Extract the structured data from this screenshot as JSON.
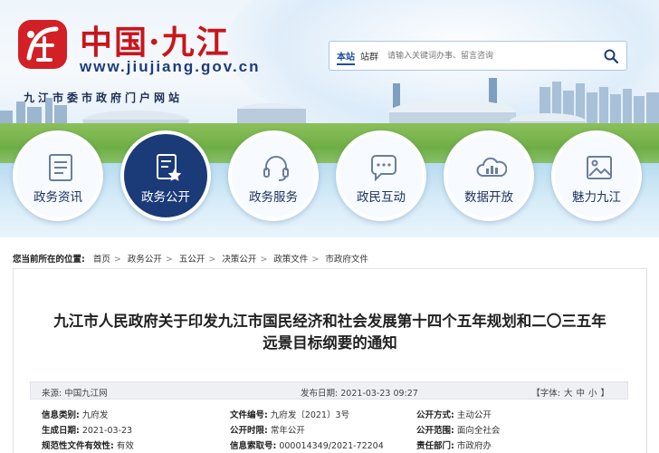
{
  "site": {
    "name_cn": "中国·九江",
    "url": "www.jiujiang.gov.cn",
    "portal": "九江市委市政府门户网站",
    "brand_red": "#c8161d",
    "brand_navy": "#1a3a78"
  },
  "search": {
    "scope_items": [
      "本站",
      "站群"
    ],
    "placeholder": "请输入关键词办事、留言咨询",
    "button_icon": "search-icon"
  },
  "nav": [
    {
      "label": "政务资讯",
      "icon": "document-list-icon",
      "active": false
    },
    {
      "label": "政务公开",
      "icon": "document-star-icon",
      "active": true
    },
    {
      "label": "政务服务",
      "icon": "headset-icon",
      "active": false
    },
    {
      "label": "政民互动",
      "icon": "chat-bubble-icon",
      "active": false
    },
    {
      "label": "数据开放",
      "icon": "bar-cloud-icon",
      "active": false
    },
    {
      "label": "魅力九江",
      "icon": "image-icon",
      "active": false
    }
  ],
  "breadcrumb": {
    "lead": "您当前所在的位置:",
    "items": [
      "首页",
      "政务公开",
      "五公开",
      "决策公开",
      "政策文件",
      "市政府文件"
    ]
  },
  "article": {
    "title_line1": "九江市人民政府关于印发九江市国民经济和社会发展第十四个五年规划和二〇三五年",
    "title_line2": "远景目标纲要的通知",
    "source_label": "来源:",
    "source_value": "中国九江网",
    "date_label": "发布日期:",
    "date_value": "2021-03-23 09:27",
    "font_label": "【字体:",
    "font_sizes": [
      "大",
      "中",
      "小"
    ],
    "font_close": "】"
  },
  "info": [
    [
      {
        "k": "信息类别:",
        "v": "九府发"
      },
      {
        "k": "文件编号:",
        "v": "九府发〔2021〕3号"
      },
      {
        "k": "公开方式:",
        "v": "主动公开"
      }
    ],
    [
      {
        "k": "生成日期:",
        "v": "2021-03-23"
      },
      {
        "k": "公开时限:",
        "v": "常年公开"
      },
      {
        "k": "公开范围:",
        "v": "面向全社会"
      }
    ],
    [
      {
        "k": "规范性文件有效性:",
        "v": "有效"
      },
      {
        "k": "信息索取号:",
        "v": "000014349/2021-72204"
      },
      {
        "k": "责任部门:",
        "v": "市政府办"
      }
    ]
  ]
}
